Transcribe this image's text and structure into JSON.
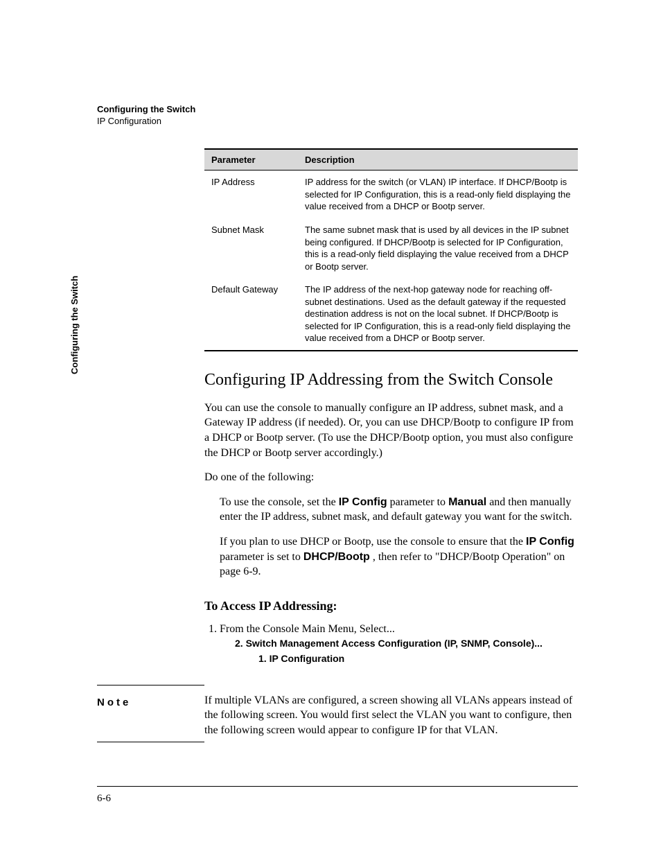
{
  "running_head": {
    "title": "Configuring the Switch",
    "subtitle": "IP Configuration"
  },
  "side_tab": "Configuring the Switch",
  "table": {
    "headers": {
      "param": "Parameter",
      "desc": "Description"
    },
    "rows": [
      {
        "param": "IP Address",
        "desc": "IP address for the switch (or VLAN) IP interface. If DHCP/Bootp is selected for IP Configuration, this is a read-only field displaying the value received from a DHCP or Bootp server."
      },
      {
        "param": "Subnet Mask",
        "desc": "The same subnet mask that is used by all devices in the IP subnet being configured. If DHCP/Bootp is selected for IP Configuration, this is a read-only field displaying the value received from a DHCP or Bootp server."
      },
      {
        "param": "Default Gateway",
        "desc": "The IP address of the next-hop gateway node for reaching off-subnet destinations. Used as the default gateway if the requested destination address is not on the local subnet.  If DHCP/Bootp is selected for IP Configuration, this is a read-only field displaying the value received from a DHCP or Bootp server."
      }
    ]
  },
  "section_heading": "Configuring IP Addressing from the Switch Console",
  "intro_paragraph": "You can use the console to manually configure an IP address, subnet mask, and a Gateway IP address (if needed). Or, you can use DHCP/Bootp to configure IP from a DHCP or Bootp server. (To use the DHCP/Bootp option, you must also configure the DHCP or Bootp server accordingly.)",
  "do_one": "Do one of the following:",
  "option1": {
    "pre": "To use the console, set the ",
    "bold1": "IP Config",
    "mid": " parameter to ",
    "bold2": "Manual",
    "post": " and then manually enter the IP address, subnet mask, and default gateway you want for the switch."
  },
  "option2": {
    "pre": "If you plan to use DHCP or Bootp, use the console to ensure that the ",
    "bold1": "IP Config",
    "mid": " parameter is set to ",
    "bold2": "DHCP/Bootp",
    "post": ", then refer to \"DHCP/Bootp Operation\" on page 6-9."
  },
  "subhead": "To Access IP Addressing:",
  "step1_text": "From the Console Main Menu, Select...",
  "menu_path": {
    "lvl1": "2. Switch Management Access Configuration (IP, SNMP, Console)...",
    "lvl2": "1. IP Configuration"
  },
  "note": {
    "label": "Note",
    "body": "If multiple VLANs are configured, a screen showing all VLANs appears instead of the following screen. You would first select the VLAN you want to configure, then the following screen would appear to configure IP for that VLAN."
  },
  "page_number": "6-6"
}
